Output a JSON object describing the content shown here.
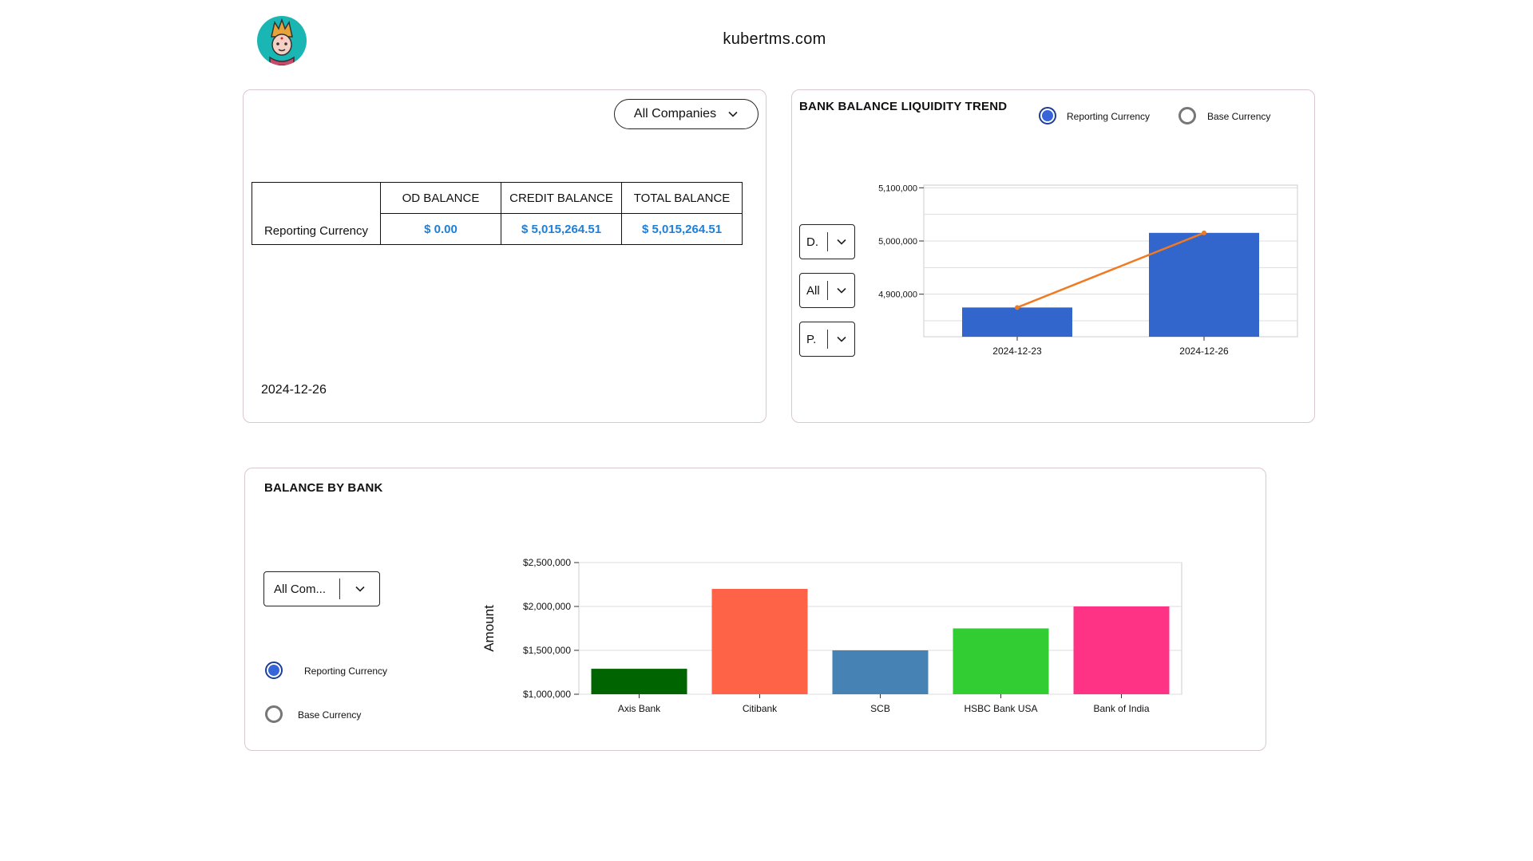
{
  "header": {
    "site_name": "kubertms.com",
    "logo_icon": "deity-avatar-icon"
  },
  "balance_card": {
    "company_dropdown": "All Companies",
    "table": {
      "columns": [
        "OD BALANCE",
        "CREDIT BALANCE",
        "TOTAL BALANCE"
      ],
      "row_label": "Reporting Currency",
      "values": [
        "$ 0.00",
        "$ 5,015,264.51",
        "$ 5,015,264.51"
      ]
    },
    "date": "2024-12-26"
  },
  "trend_card": {
    "title": "BANK BALANCE LIQUIDITY TREND",
    "radios": [
      {
        "label": "Reporting Currency",
        "selected": true
      },
      {
        "label": "Base Currency",
        "selected": false
      }
    ],
    "selects": [
      "D.",
      "All",
      "P."
    ]
  },
  "bank_card": {
    "title": "BALANCE BY BANK",
    "company_select": "All Com...",
    "radios": [
      {
        "label": "Reporting Currency",
        "selected": true
      },
      {
        "label": "Base Currency",
        "selected": false
      }
    ]
  },
  "colors": {
    "accent_blue": "#3565d9",
    "value_blue": "#1e7fd8",
    "trend_line": "#f07a22"
  },
  "chart_data": [
    {
      "type": "bar",
      "categories": [
        "2024-12-23",
        "2024-12-26"
      ],
      "series": [
        {
          "type": "bar",
          "values": [
            4875000,
            5015264.51
          ],
          "color": "#3366cc"
        },
        {
          "type": "line",
          "values": [
            4875000,
            5015264.51
          ],
          "color": "#f07a22"
        }
      ],
      "yticks": [
        "4,900,000",
        "5,000,000",
        "5,100,000"
      ],
      "ylim": [
        4820000,
        5105000
      ],
      "grid": true
    },
    {
      "type": "bar",
      "categories": [
        "Axis Bank",
        "Citibank",
        "SCB",
        "HSBC Bank USA",
        "Bank of India"
      ],
      "values": [
        1290000,
        2200000,
        1500000,
        1750000,
        2000000
      ],
      "colors": [
        "#006400",
        "#ff6347",
        "#4682b4",
        "#32cd32",
        "#ff3385"
      ],
      "ylabel": "Amount",
      "yticks": [
        "$1,000,000",
        "$1,500,000",
        "$2,000,000",
        "$2,500,000"
      ],
      "ylim": [
        1000000,
        2500000
      ],
      "grid": true
    }
  ]
}
